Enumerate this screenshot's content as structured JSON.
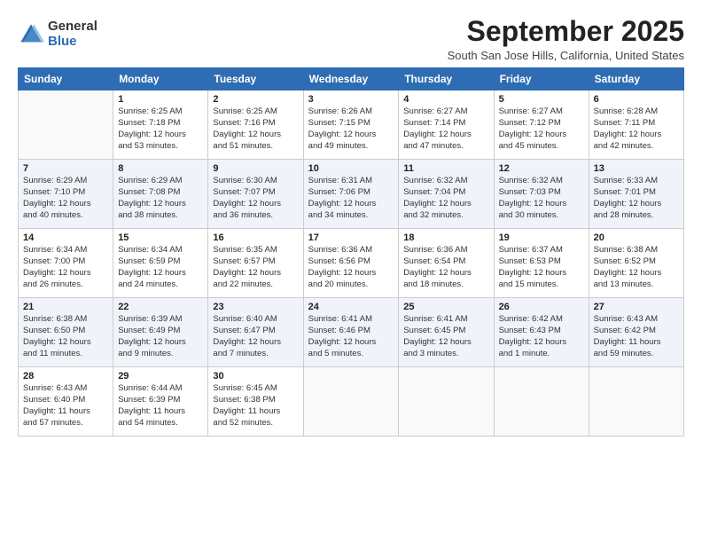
{
  "logo": {
    "general": "General",
    "blue": "Blue"
  },
  "title": "September 2025",
  "location": "South San Jose Hills, California, United States",
  "weekdays": [
    "Sunday",
    "Monday",
    "Tuesday",
    "Wednesday",
    "Thursday",
    "Friday",
    "Saturday"
  ],
  "weeks": [
    [
      {
        "day": "",
        "info": ""
      },
      {
        "day": "1",
        "info": "Sunrise: 6:25 AM\nSunset: 7:18 PM\nDaylight: 12 hours\nand 53 minutes."
      },
      {
        "day": "2",
        "info": "Sunrise: 6:25 AM\nSunset: 7:16 PM\nDaylight: 12 hours\nand 51 minutes."
      },
      {
        "day": "3",
        "info": "Sunrise: 6:26 AM\nSunset: 7:15 PM\nDaylight: 12 hours\nand 49 minutes."
      },
      {
        "day": "4",
        "info": "Sunrise: 6:27 AM\nSunset: 7:14 PM\nDaylight: 12 hours\nand 47 minutes."
      },
      {
        "day": "5",
        "info": "Sunrise: 6:27 AM\nSunset: 7:12 PM\nDaylight: 12 hours\nand 45 minutes."
      },
      {
        "day": "6",
        "info": "Sunrise: 6:28 AM\nSunset: 7:11 PM\nDaylight: 12 hours\nand 42 minutes."
      }
    ],
    [
      {
        "day": "7",
        "info": "Sunrise: 6:29 AM\nSunset: 7:10 PM\nDaylight: 12 hours\nand 40 minutes."
      },
      {
        "day": "8",
        "info": "Sunrise: 6:29 AM\nSunset: 7:08 PM\nDaylight: 12 hours\nand 38 minutes."
      },
      {
        "day": "9",
        "info": "Sunrise: 6:30 AM\nSunset: 7:07 PM\nDaylight: 12 hours\nand 36 minutes."
      },
      {
        "day": "10",
        "info": "Sunrise: 6:31 AM\nSunset: 7:06 PM\nDaylight: 12 hours\nand 34 minutes."
      },
      {
        "day": "11",
        "info": "Sunrise: 6:32 AM\nSunset: 7:04 PM\nDaylight: 12 hours\nand 32 minutes."
      },
      {
        "day": "12",
        "info": "Sunrise: 6:32 AM\nSunset: 7:03 PM\nDaylight: 12 hours\nand 30 minutes."
      },
      {
        "day": "13",
        "info": "Sunrise: 6:33 AM\nSunset: 7:01 PM\nDaylight: 12 hours\nand 28 minutes."
      }
    ],
    [
      {
        "day": "14",
        "info": "Sunrise: 6:34 AM\nSunset: 7:00 PM\nDaylight: 12 hours\nand 26 minutes."
      },
      {
        "day": "15",
        "info": "Sunrise: 6:34 AM\nSunset: 6:59 PM\nDaylight: 12 hours\nand 24 minutes."
      },
      {
        "day": "16",
        "info": "Sunrise: 6:35 AM\nSunset: 6:57 PM\nDaylight: 12 hours\nand 22 minutes."
      },
      {
        "day": "17",
        "info": "Sunrise: 6:36 AM\nSunset: 6:56 PM\nDaylight: 12 hours\nand 20 minutes."
      },
      {
        "day": "18",
        "info": "Sunrise: 6:36 AM\nSunset: 6:54 PM\nDaylight: 12 hours\nand 18 minutes."
      },
      {
        "day": "19",
        "info": "Sunrise: 6:37 AM\nSunset: 6:53 PM\nDaylight: 12 hours\nand 15 minutes."
      },
      {
        "day": "20",
        "info": "Sunrise: 6:38 AM\nSunset: 6:52 PM\nDaylight: 12 hours\nand 13 minutes."
      }
    ],
    [
      {
        "day": "21",
        "info": "Sunrise: 6:38 AM\nSunset: 6:50 PM\nDaylight: 12 hours\nand 11 minutes."
      },
      {
        "day": "22",
        "info": "Sunrise: 6:39 AM\nSunset: 6:49 PM\nDaylight: 12 hours\nand 9 minutes."
      },
      {
        "day": "23",
        "info": "Sunrise: 6:40 AM\nSunset: 6:47 PM\nDaylight: 12 hours\nand 7 minutes."
      },
      {
        "day": "24",
        "info": "Sunrise: 6:41 AM\nSunset: 6:46 PM\nDaylight: 12 hours\nand 5 minutes."
      },
      {
        "day": "25",
        "info": "Sunrise: 6:41 AM\nSunset: 6:45 PM\nDaylight: 12 hours\nand 3 minutes."
      },
      {
        "day": "26",
        "info": "Sunrise: 6:42 AM\nSunset: 6:43 PM\nDaylight: 12 hours\nand 1 minute."
      },
      {
        "day": "27",
        "info": "Sunrise: 6:43 AM\nSunset: 6:42 PM\nDaylight: 11 hours\nand 59 minutes."
      }
    ],
    [
      {
        "day": "28",
        "info": "Sunrise: 6:43 AM\nSunset: 6:40 PM\nDaylight: 11 hours\nand 57 minutes."
      },
      {
        "day": "29",
        "info": "Sunrise: 6:44 AM\nSunset: 6:39 PM\nDaylight: 11 hours\nand 54 minutes."
      },
      {
        "day": "30",
        "info": "Sunrise: 6:45 AM\nSunset: 6:38 PM\nDaylight: 11 hours\nand 52 minutes."
      },
      {
        "day": "",
        "info": ""
      },
      {
        "day": "",
        "info": ""
      },
      {
        "day": "",
        "info": ""
      },
      {
        "day": "",
        "info": ""
      }
    ]
  ]
}
